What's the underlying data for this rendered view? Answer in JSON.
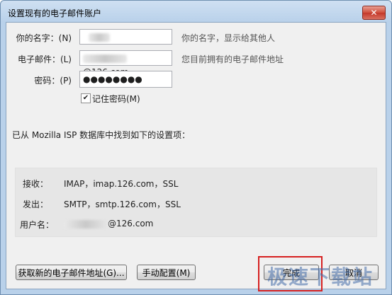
{
  "window": {
    "title": "设置现有的电子邮件账户",
    "close_symbol": "✕"
  },
  "form": {
    "name_label": "你的名字：(N)",
    "name_hint": "你的名字，显示给其他人",
    "email_label": "电子邮件：(L)",
    "email_value_suffix": "@126.com",
    "email_hint": "您目前拥有的电子邮件地址",
    "password_label": "密码：(P)",
    "password_value": "●●●●●●●●",
    "remember_label": "记住密码(M)",
    "remember_checked": "✔"
  },
  "found_text": "已从 Mozilla ISP 数据库中找到如下的设置项：",
  "settings": {
    "incoming_label": "接收：",
    "incoming_value": "IMAP，imap.126.com，SSL",
    "outgoing_label": "发出：",
    "outgoing_value": "SMTP，smtp.126.com，SSL",
    "username_label": "用户名：",
    "username_suffix": "@126.com"
  },
  "buttons": {
    "get_new": "获取新的电子邮件地址(G)...",
    "manual": "手动配置(M)",
    "done": "完成",
    "cancel": "取消"
  },
  "watermark": "极速下载站",
  "colors": {
    "highlight": "#d62020",
    "titlebar": "#b9d1ea"
  }
}
